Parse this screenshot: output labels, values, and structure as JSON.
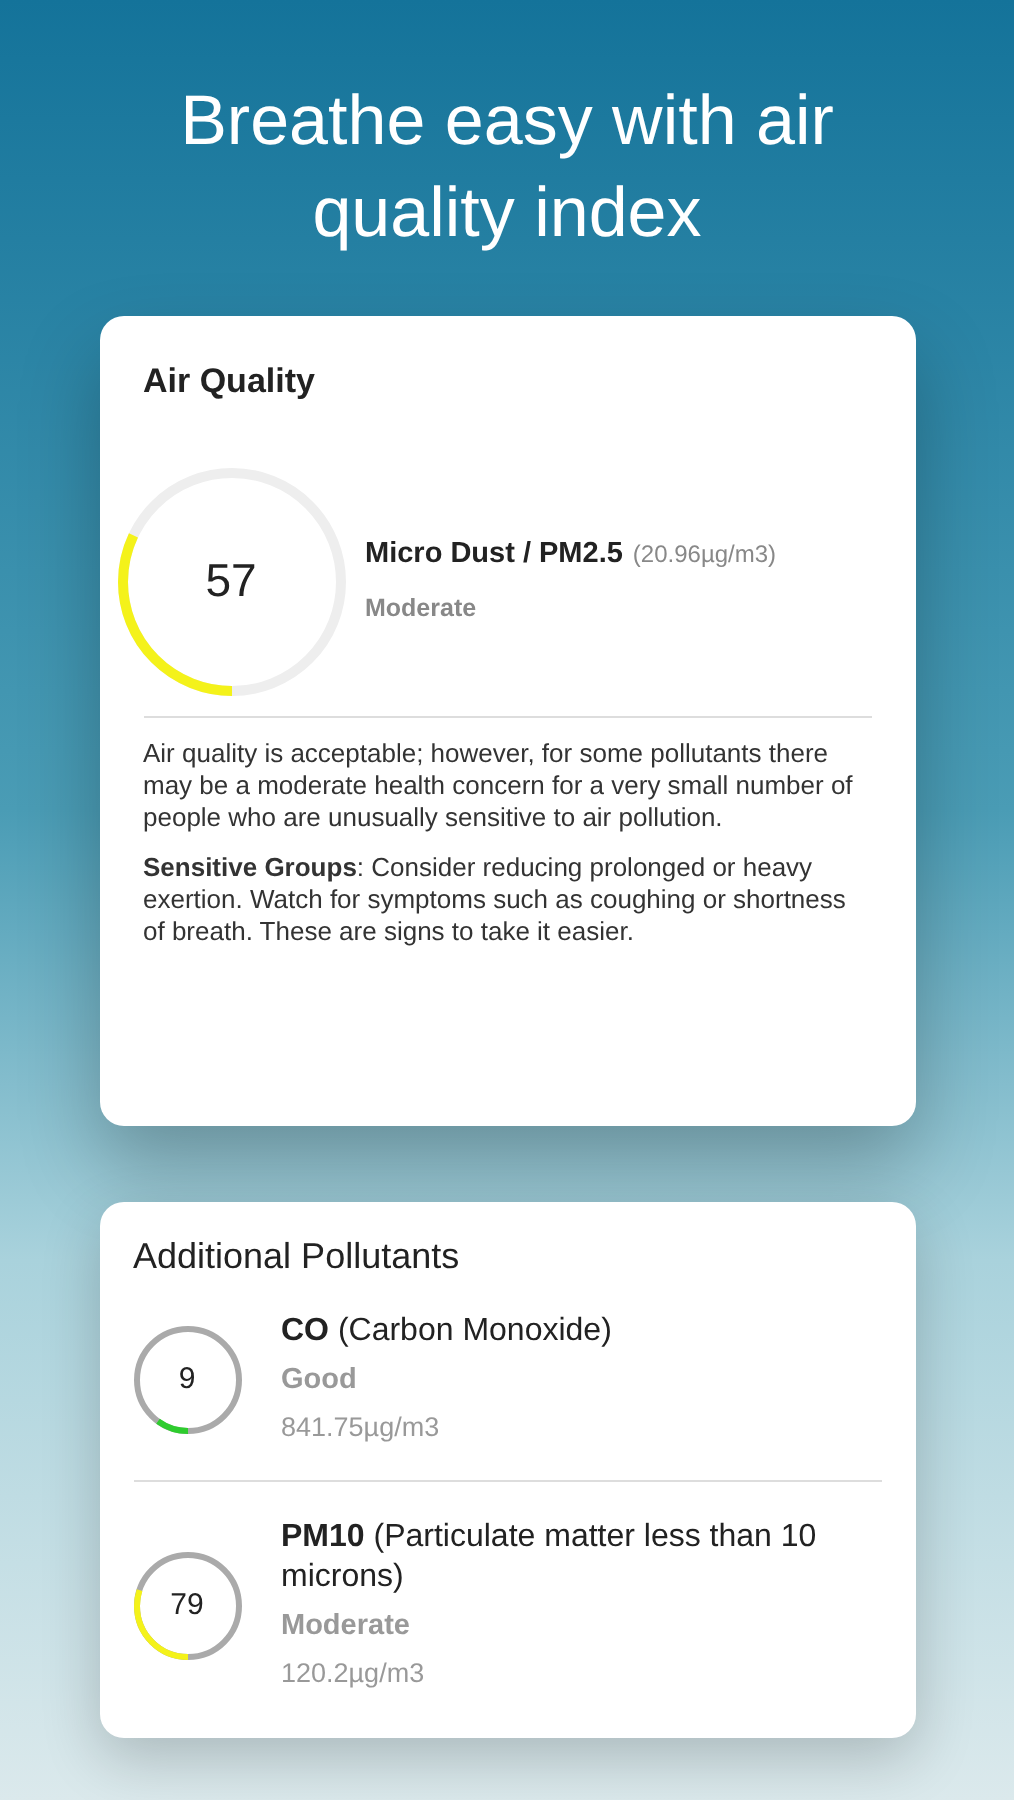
{
  "headline": "Breathe easy with air quality index",
  "air_quality": {
    "title": "Air Quality",
    "gauge": {
      "value": "57",
      "level": 0.32,
      "color": "#f4f21a"
    },
    "pollutant": "Micro Dust / PM2.5",
    "concentration": "(20.96µg/m3)",
    "status": "Moderate",
    "description": "Air quality is acceptable; however, for some pollutants there may be a moderate health concern for a very small number of people who are unusually sensitive to air pollution.",
    "advice": "**Sensitive Groups**: Consider reducing prolonged or heavy exertion. Watch for symptoms such as coughing or shortness of breath. These are signs to take it easier."
  },
  "additional": {
    "title": "Additional Pollutants",
    "items": [
      {
        "value": "9",
        "level": 0.1,
        "color": "#2ecc2e",
        "name": "**CO** (Carbon Monoxide)",
        "status": "Good",
        "concentration": "841.75µg/m3"
      },
      {
        "value": "79",
        "level": 0.3,
        "color": "#f4f21a",
        "name": "**PM10** (Particulate matter less than 10 microns)",
        "status": "Moderate",
        "concentration": "120.2µg/m3"
      }
    ]
  }
}
